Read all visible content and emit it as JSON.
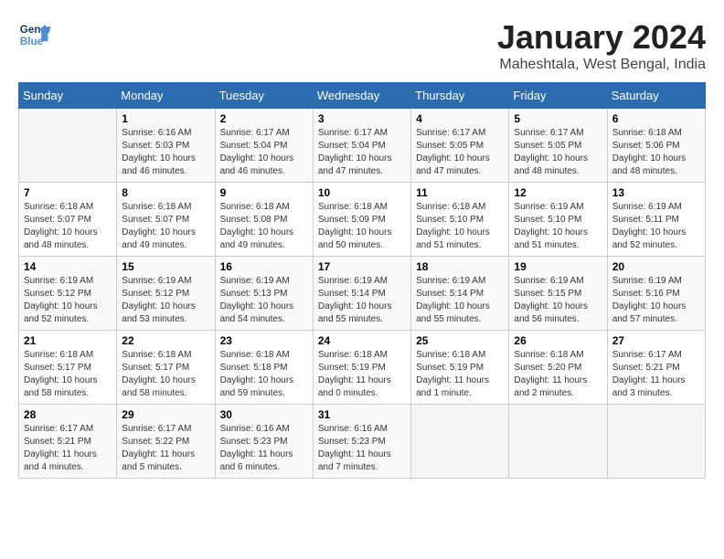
{
  "header": {
    "logo_line1": "General",
    "logo_line2": "Blue",
    "month_title": "January 2024",
    "location": "Maheshtala, West Bengal, India"
  },
  "weekdays": [
    "Sunday",
    "Monday",
    "Tuesday",
    "Wednesday",
    "Thursday",
    "Friday",
    "Saturday"
  ],
  "weeks": [
    [
      {
        "day": "",
        "sunrise": "",
        "sunset": "",
        "daylight": ""
      },
      {
        "day": "1",
        "sunrise": "6:16 AM",
        "sunset": "5:03 PM",
        "daylight": "10 hours and 46 minutes."
      },
      {
        "day": "2",
        "sunrise": "6:17 AM",
        "sunset": "5:04 PM",
        "daylight": "10 hours and 46 minutes."
      },
      {
        "day": "3",
        "sunrise": "6:17 AM",
        "sunset": "5:04 PM",
        "daylight": "10 hours and 47 minutes."
      },
      {
        "day": "4",
        "sunrise": "6:17 AM",
        "sunset": "5:05 PM",
        "daylight": "10 hours and 47 minutes."
      },
      {
        "day": "5",
        "sunrise": "6:17 AM",
        "sunset": "5:05 PM",
        "daylight": "10 hours and 48 minutes."
      },
      {
        "day": "6",
        "sunrise": "6:18 AM",
        "sunset": "5:06 PM",
        "daylight": "10 hours and 48 minutes."
      }
    ],
    [
      {
        "day": "7",
        "sunrise": "6:18 AM",
        "sunset": "5:07 PM",
        "daylight": "10 hours and 48 minutes."
      },
      {
        "day": "8",
        "sunrise": "6:18 AM",
        "sunset": "5:07 PM",
        "daylight": "10 hours and 49 minutes."
      },
      {
        "day": "9",
        "sunrise": "6:18 AM",
        "sunset": "5:08 PM",
        "daylight": "10 hours and 49 minutes."
      },
      {
        "day": "10",
        "sunrise": "6:18 AM",
        "sunset": "5:09 PM",
        "daylight": "10 hours and 50 minutes."
      },
      {
        "day": "11",
        "sunrise": "6:18 AM",
        "sunset": "5:10 PM",
        "daylight": "10 hours and 51 minutes."
      },
      {
        "day": "12",
        "sunrise": "6:19 AM",
        "sunset": "5:10 PM",
        "daylight": "10 hours and 51 minutes."
      },
      {
        "day": "13",
        "sunrise": "6:19 AM",
        "sunset": "5:11 PM",
        "daylight": "10 hours and 52 minutes."
      }
    ],
    [
      {
        "day": "14",
        "sunrise": "6:19 AM",
        "sunset": "5:12 PM",
        "daylight": "10 hours and 52 minutes."
      },
      {
        "day": "15",
        "sunrise": "6:19 AM",
        "sunset": "5:12 PM",
        "daylight": "10 hours and 53 minutes."
      },
      {
        "day": "16",
        "sunrise": "6:19 AM",
        "sunset": "5:13 PM",
        "daylight": "10 hours and 54 minutes."
      },
      {
        "day": "17",
        "sunrise": "6:19 AM",
        "sunset": "5:14 PM",
        "daylight": "10 hours and 55 minutes."
      },
      {
        "day": "18",
        "sunrise": "6:19 AM",
        "sunset": "5:14 PM",
        "daylight": "10 hours and 55 minutes."
      },
      {
        "day": "19",
        "sunrise": "6:19 AM",
        "sunset": "5:15 PM",
        "daylight": "10 hours and 56 minutes."
      },
      {
        "day": "20",
        "sunrise": "6:19 AM",
        "sunset": "5:16 PM",
        "daylight": "10 hours and 57 minutes."
      }
    ],
    [
      {
        "day": "21",
        "sunrise": "6:18 AM",
        "sunset": "5:17 PM",
        "daylight": "10 hours and 58 minutes."
      },
      {
        "day": "22",
        "sunrise": "6:18 AM",
        "sunset": "5:17 PM",
        "daylight": "10 hours and 58 minutes."
      },
      {
        "day": "23",
        "sunrise": "6:18 AM",
        "sunset": "5:18 PM",
        "daylight": "10 hours and 59 minutes."
      },
      {
        "day": "24",
        "sunrise": "6:18 AM",
        "sunset": "5:19 PM",
        "daylight": "11 hours and 0 minutes."
      },
      {
        "day": "25",
        "sunrise": "6:18 AM",
        "sunset": "5:19 PM",
        "daylight": "11 hours and 1 minute."
      },
      {
        "day": "26",
        "sunrise": "6:18 AM",
        "sunset": "5:20 PM",
        "daylight": "11 hours and 2 minutes."
      },
      {
        "day": "27",
        "sunrise": "6:17 AM",
        "sunset": "5:21 PM",
        "daylight": "11 hours and 3 minutes."
      }
    ],
    [
      {
        "day": "28",
        "sunrise": "6:17 AM",
        "sunset": "5:21 PM",
        "daylight": "11 hours and 4 minutes."
      },
      {
        "day": "29",
        "sunrise": "6:17 AM",
        "sunset": "5:22 PM",
        "daylight": "11 hours and 5 minutes."
      },
      {
        "day": "30",
        "sunrise": "6:16 AM",
        "sunset": "5:23 PM",
        "daylight": "11 hours and 6 minutes."
      },
      {
        "day": "31",
        "sunrise": "6:16 AM",
        "sunset": "5:23 PM",
        "daylight": "11 hours and 7 minutes."
      },
      {
        "day": "",
        "sunrise": "",
        "sunset": "",
        "daylight": ""
      },
      {
        "day": "",
        "sunrise": "",
        "sunset": "",
        "daylight": ""
      },
      {
        "day": "",
        "sunrise": "",
        "sunset": "",
        "daylight": ""
      }
    ]
  ]
}
